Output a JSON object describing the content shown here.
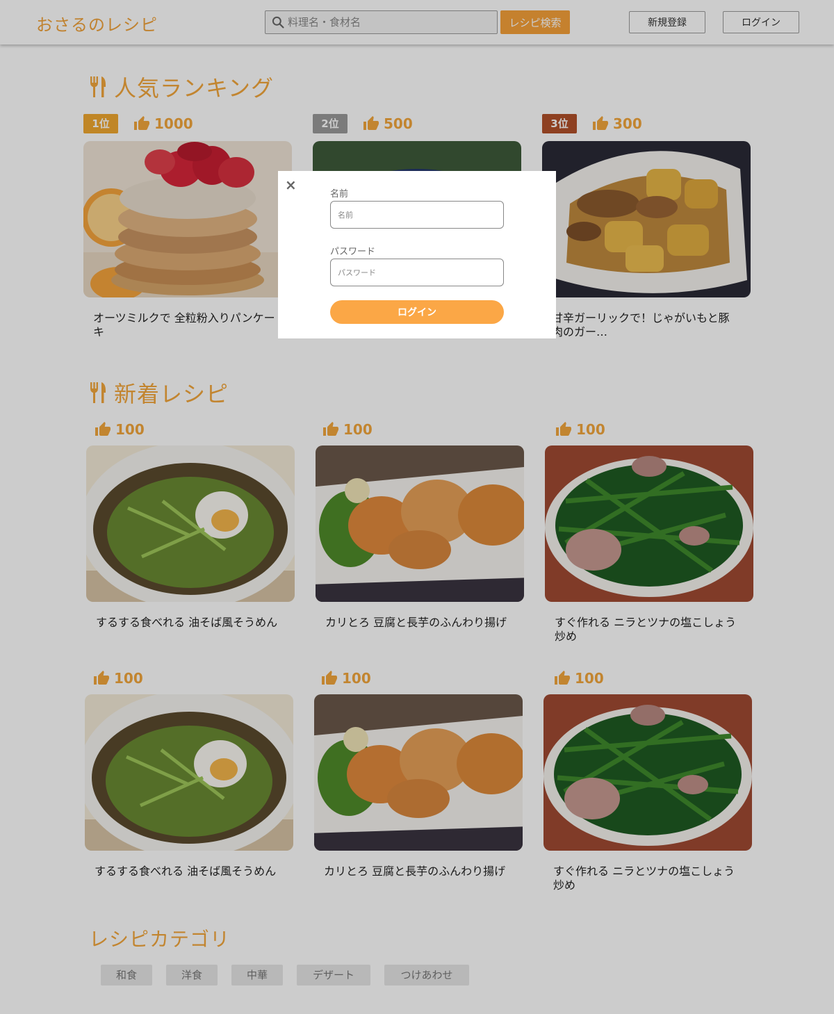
{
  "header": {
    "logo": "おさるのレシピ",
    "search_placeholder": "料理名・食材名",
    "search_button": "レシピ検索",
    "register_button": "新規登録",
    "login_button": "ログイン"
  },
  "ranking": {
    "title": "人気ランキング",
    "items": [
      {
        "rank": "1位",
        "rank_color": "#f0a830",
        "likes": "1000",
        "title": "オーツミルクで 全粒粉入りパンケーキ",
        "image": "pancake-photo"
      },
      {
        "rank": "2位",
        "rank_color": "#9a9a9a",
        "likes": "500",
        "title": "",
        "image": "salad-bowl-photo"
      },
      {
        "rank": "3位",
        "rank_color": "#b2512a",
        "likes": "300",
        "title": "甘辛ガーリックで！じゃがいもと豚肉のガー…",
        "image": "potato-pork-photo"
      }
    ]
  },
  "new_recipes": {
    "title": "新着レシピ",
    "items": [
      {
        "likes": "100",
        "title": "するする食べれる 油そば風そうめん",
        "image": "somen-photo"
      },
      {
        "likes": "100",
        "title": "カリとろ 豆腐と長芋のふんわり揚げ",
        "image": "fritter-photo"
      },
      {
        "likes": "100",
        "title": "すぐ作れる ニラとツナの塩こしょう炒め",
        "image": "nira-tuna-photo"
      },
      {
        "likes": "100",
        "title": "するする食べれる 油そば風そうめん",
        "image": "somen-photo"
      },
      {
        "likes": "100",
        "title": "カリとろ 豆腐と長芋のふんわり揚げ",
        "image": "fritter-photo"
      },
      {
        "likes": "100",
        "title": "すぐ作れる ニラとツナの塩こしょう炒め",
        "image": "nira-tuna-photo"
      }
    ]
  },
  "categories": {
    "title": "レシピカテゴリ",
    "items": [
      "和食",
      "洋食",
      "中華",
      "デザート",
      "つけあわせ"
    ]
  },
  "login_modal": {
    "close": "×",
    "name_label": "名前",
    "name_placeholder": "名前",
    "password_label": "パスワード",
    "password_placeholder": "パスワード",
    "submit": "ログイン"
  },
  "colors": {
    "accent": "#f3a73c",
    "button": "#fba746"
  }
}
